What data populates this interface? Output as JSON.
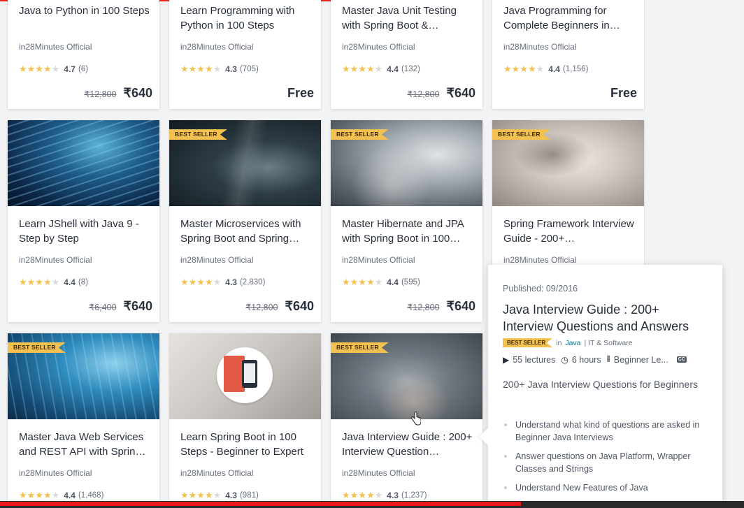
{
  "cards": [
    {
      "title": "Java to Python in 100 Steps",
      "author": "in28Minutes Official",
      "rating": "4.7",
      "count": "(6)",
      "old_price": "₹12,800",
      "price": "₹640",
      "badge": ""
    },
    {
      "title": "Learn Programming with Python in 100 Steps",
      "author": "in28Minutes Official",
      "rating": "4.3",
      "count": "(705)",
      "old_price": "",
      "price": "Free",
      "badge": ""
    },
    {
      "title": "Master Java Unit Testing with Spring Boot &…",
      "author": "in28Minutes Official",
      "rating": "4.4",
      "count": "(132)",
      "old_price": "₹12,800",
      "price": "₹640",
      "badge": ""
    },
    {
      "title": "Java Programming for Complete Beginners in…",
      "author": "in28Minutes Official",
      "rating": "4.4",
      "count": "(1,156)",
      "old_price": "",
      "price": "Free",
      "badge": ""
    },
    {
      "title": "Learn JShell with Java 9 - Step by Step",
      "author": "in28Minutes Official",
      "rating": "4.4",
      "count": "(8)",
      "old_price": "₹6,400",
      "price": "₹640",
      "badge": ""
    },
    {
      "title": "Master Microservices with Spring Boot and Spring…",
      "author": "in28Minutes Official",
      "rating": "4.3",
      "count": "(2,830)",
      "old_price": "₹12,800",
      "price": "₹640",
      "badge": "BEST SELLER"
    },
    {
      "title": "Master Hibernate and JPA with Spring Boot in 100…",
      "author": "in28Minutes Official",
      "rating": "4.4",
      "count": "(595)",
      "old_price": "₹12,800",
      "price": "₹640",
      "badge": "BEST SELLER"
    },
    {
      "title": "Spring Framework Interview Guide - 200+…",
      "author": "in28Minutes Official",
      "rating": "",
      "count": "",
      "old_price": "",
      "price": "",
      "badge": "BEST SELLER"
    },
    {
      "title": "Master Java Web Services and REST API with Sprin…",
      "author": "in28Minutes Official",
      "rating": "4.4",
      "count": "(1,468)",
      "old_price": "",
      "price": "",
      "badge": "BEST SELLER"
    },
    {
      "title": "Learn Spring Boot in 100 Steps - Beginner to Expert",
      "author": "in28Minutes Official",
      "rating": "4.3",
      "count": "(981)",
      "old_price": "",
      "price": "",
      "badge": ""
    },
    {
      "title": "Java Interview Guide : 200+ Interview Question…",
      "author": "in28Minutes Official",
      "rating": "4.3",
      "count": "(1,237)",
      "old_price": "",
      "price": "",
      "badge": "BEST SELLER"
    }
  ],
  "popup": {
    "published": "Published: 09/2016",
    "title": "Java Interview Guide : 200+ Interview Questions and Answers",
    "badge": "BEST SELLER",
    "in_label": "in",
    "category": "Java",
    "subcategory": "| IT & Software",
    "lectures": "55 lectures",
    "hours": "6 hours",
    "level": "Beginner Le...",
    "cc": "CC",
    "description": "200+ Java Interview Questions for Beginners",
    "bullets": [
      "Understand what kind of questions are asked in Beginner Java Interviews",
      "Answer questions on Java Platform, Wrapper Classes and Strings",
      "Understand New Features of Java"
    ]
  },
  "colors": {
    "accent": "#f4c150",
    "link": "#007791",
    "progress": "#ec1a1a"
  },
  "video_progress": 0.7
}
